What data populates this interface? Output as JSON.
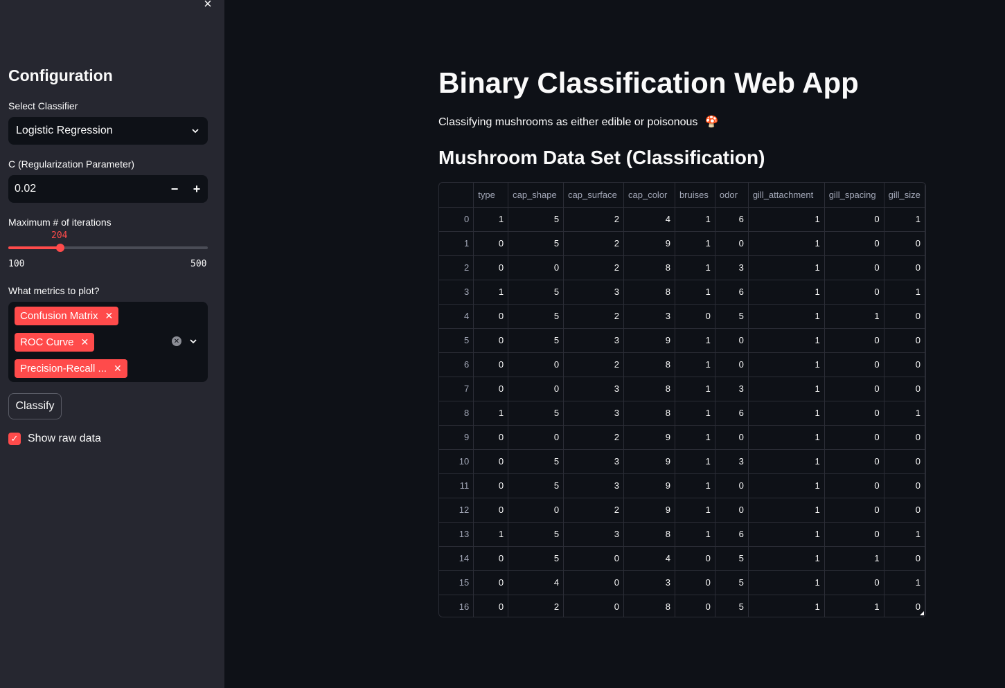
{
  "sidebar": {
    "close_symbol": "×",
    "title": "Configuration",
    "classifier_label": "Select Classifier",
    "classifier_value": "Logistic Regression",
    "c_label": "C (Regularization Parameter)",
    "c_value": "0.02",
    "iter_label": "Maximum # of iterations",
    "iter_value": "204",
    "iter_min": "100",
    "iter_max": "500",
    "iter_fraction": 0.26,
    "metrics_label": "What metrics to plot?",
    "metrics": [
      "Confusion Matrix",
      "ROC Curve",
      "Precision-Recall ..."
    ],
    "classify_label": "Classify",
    "show_raw_label": "Show raw data",
    "show_raw_checked": true
  },
  "main": {
    "title": "Binary Classification Web App",
    "subtitle": "Classifying mushrooms as either edible or poisonous",
    "subtitle_icon": "🍄",
    "dataset_heading": "Mushroom Data Set (Classification)"
  },
  "table": {
    "columns": [
      "",
      "type",
      "cap_shape",
      "cap_surface",
      "cap_color",
      "bruises",
      "odor",
      "gill_attachment",
      "gill_spacing",
      "gill_size"
    ],
    "rows": [
      [
        "0",
        "1",
        "5",
        "2",
        "4",
        "1",
        "6",
        "1",
        "0",
        "1"
      ],
      [
        "1",
        "0",
        "5",
        "2",
        "9",
        "1",
        "0",
        "1",
        "0",
        "0"
      ],
      [
        "2",
        "0",
        "0",
        "2",
        "8",
        "1",
        "3",
        "1",
        "0",
        "0"
      ],
      [
        "3",
        "1",
        "5",
        "3",
        "8",
        "1",
        "6",
        "1",
        "0",
        "1"
      ],
      [
        "4",
        "0",
        "5",
        "2",
        "3",
        "0",
        "5",
        "1",
        "1",
        "0"
      ],
      [
        "5",
        "0",
        "5",
        "3",
        "9",
        "1",
        "0",
        "1",
        "0",
        "0"
      ],
      [
        "6",
        "0",
        "0",
        "2",
        "8",
        "1",
        "0",
        "1",
        "0",
        "0"
      ],
      [
        "7",
        "0",
        "0",
        "3",
        "8",
        "1",
        "3",
        "1",
        "0",
        "0"
      ],
      [
        "8",
        "1",
        "5",
        "3",
        "8",
        "1",
        "6",
        "1",
        "0",
        "1"
      ],
      [
        "9",
        "0",
        "0",
        "2",
        "9",
        "1",
        "0",
        "1",
        "0",
        "0"
      ],
      [
        "10",
        "0",
        "5",
        "3",
        "9",
        "1",
        "3",
        "1",
        "0",
        "0"
      ],
      [
        "11",
        "0",
        "5",
        "3",
        "9",
        "1",
        "0",
        "1",
        "0",
        "0"
      ],
      [
        "12",
        "0",
        "0",
        "2",
        "9",
        "1",
        "0",
        "1",
        "0",
        "0"
      ],
      [
        "13",
        "1",
        "5",
        "3",
        "8",
        "1",
        "6",
        "1",
        "0",
        "1"
      ],
      [
        "14",
        "0",
        "5",
        "0",
        "4",
        "0",
        "5",
        "1",
        "1",
        "0"
      ],
      [
        "15",
        "0",
        "4",
        "0",
        "3",
        "0",
        "5",
        "1",
        "0",
        "1"
      ],
      [
        "16",
        "0",
        "2",
        "0",
        "8",
        "0",
        "5",
        "1",
        "1",
        "0"
      ]
    ]
  },
  "colors": {
    "accent": "#ff4b4b",
    "sidebar_bg": "#262730",
    "main_bg": "#0e1117"
  }
}
